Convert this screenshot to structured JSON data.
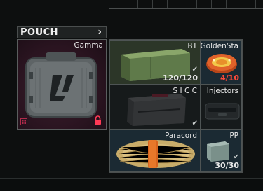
{
  "pouch": {
    "title": "POUCH",
    "item": {
      "name": "Gamma",
      "icon": "gamma-container-icon",
      "lock_icon": "lock-icon",
      "grid_icon": "grid-icon"
    }
  },
  "container": {
    "items": [
      {
        "name": "BT",
        "count": "120/120",
        "icon": "ammo-box-icon",
        "checked": true
      },
      {
        "name": "GoldenSta",
        "count": "4/10",
        "count_color": "#ff4a3a",
        "icon": "golden-star-balm-icon"
      },
      {
        "name": "S I C C",
        "icon": "sicc-case-icon",
        "checked": true
      },
      {
        "name": "Injectors",
        "icon": "injector-case-icon"
      },
      {
        "name": "Paracord",
        "icon": "paracord-icon"
      },
      {
        "name": "PP",
        "count": "30/30",
        "icon": "pp-ammo-box-icon",
        "checked": true
      }
    ]
  },
  "colors": {
    "pouch_bg": "#2a1420",
    "green_slot": "#2c3628",
    "blue_slot": "#1b2a33",
    "count_red": "#ff4a3a"
  }
}
